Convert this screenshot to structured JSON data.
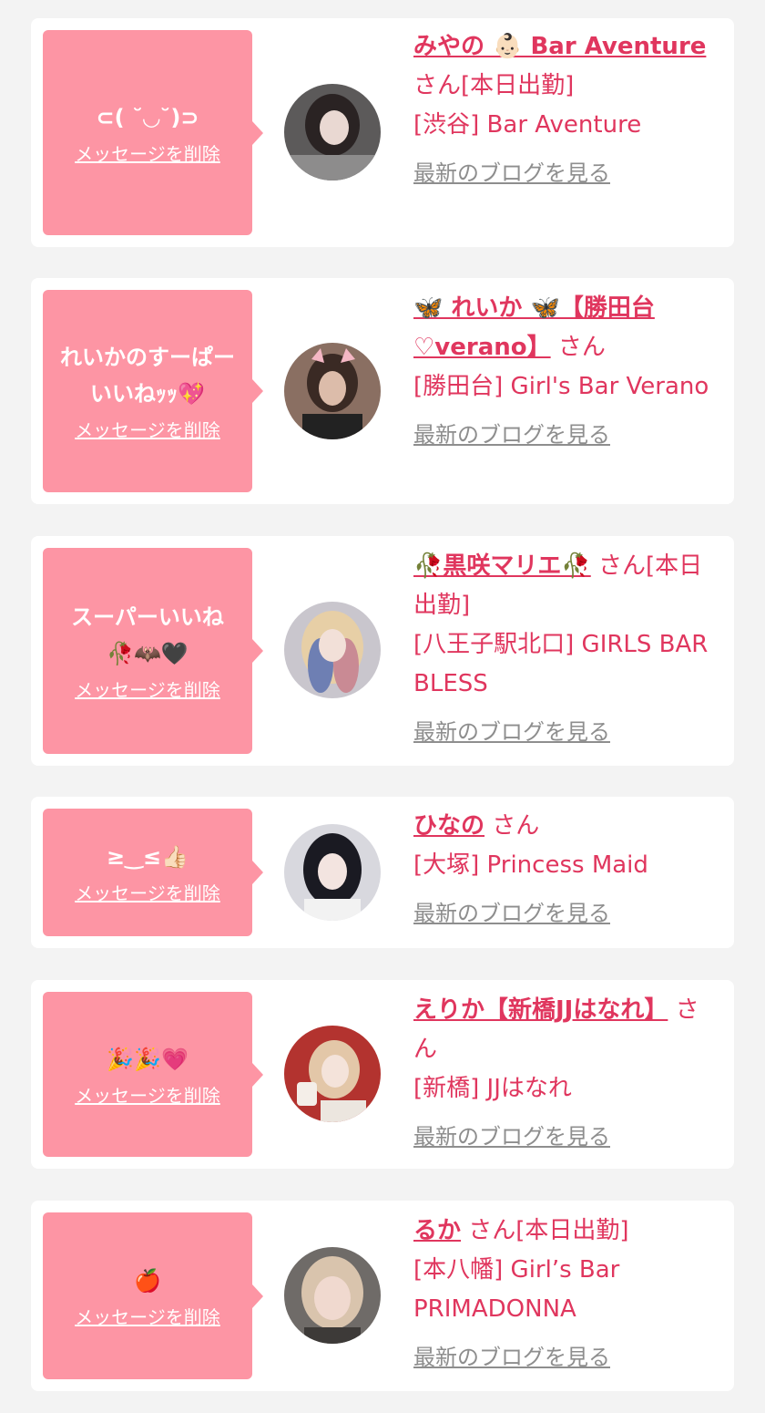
{
  "delete_label": "メッセージを削除",
  "blog_label": "最新のブログを見る",
  "colors": {
    "accent": "#e0365e",
    "bubble": "#fd95a4",
    "link_gray": "#8e8e8e",
    "background": "#f3f3f3"
  },
  "items": [
    {
      "message": "⊂( ˘◡˘)⊃",
      "name": "みやの 👶🏻 Bar Aventure",
      "suffix": "さん[本日出勤]",
      "shop": "[渋谷] Bar Aventure"
    },
    {
      "message": "れいかのすーぱー\nいいねｯｯ💖",
      "name": "🦋 れいか 🦋【勝田台♡verano】",
      "suffix": "さん",
      "shop": "[勝田台] Girl's Bar Verano"
    },
    {
      "message": "スーパーいいね\n🥀🦇🖤",
      "name": "🥀黒咲マリエ🥀",
      "suffix": "さん[本日出勤]",
      "shop": "[八王子駅北口] GIRLS BAR BLESS"
    },
    {
      "message": "≥‿≤👍🏻",
      "name": "ひなの",
      "suffix": "さん",
      "shop": "[大塚] Princess Maid"
    },
    {
      "message": "🎉🎉💗",
      "name": "えりか【新橋JJはなれ】",
      "suffix": "さん",
      "shop": "[新橋] JJはなれ"
    },
    {
      "message": "🍎",
      "name": "るか",
      "suffix": "さん[本日出勤]",
      "shop": "[本八幡] Girl’s Bar PRIMADONNA"
    }
  ]
}
